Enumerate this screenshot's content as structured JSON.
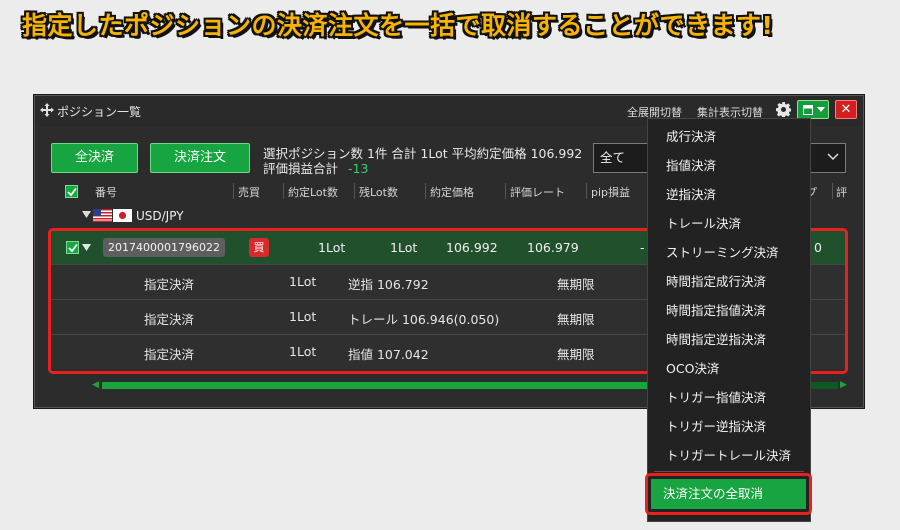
{
  "headline": "指定したポジションの決済注文を一括で取消することができます!",
  "window": {
    "title": "ポジション一覧",
    "expand_toggle": "全展開切替",
    "summary_toggle": "集計表示切替",
    "close_label": "✕"
  },
  "toolbar": {
    "settle_all": "全決済",
    "settle_order": "決済注文",
    "summary_line1": "選択ポジション数 1件  合計 1Lot 平均約定価格 106.992",
    "summary_label2": "評価損益合計",
    "summary_value2": "-13",
    "filter_value": "全て"
  },
  "columns": [
    "番号",
    "売買",
    "約定Lot数",
    "残Lot数",
    "約定価格",
    "評価レート",
    "pip損益",
    "プ",
    "評"
  ],
  "group": {
    "symbol": "USD/JPY"
  },
  "position": {
    "id": "2017400001796022",
    "side": "買",
    "lot": "1Lot",
    "remain": "1Lot",
    "price": "106.992",
    "rate": "106.979",
    "pips": "-",
    "last": "0"
  },
  "orders": [
    {
      "type": "指定決済",
      "lot": "1Lot",
      "detail": "逆指 106.792",
      "expiry": "無期限"
    },
    {
      "type": "指定決済",
      "lot": "1Lot",
      "detail": "トレール 106.946(0.050)",
      "expiry": "無期限"
    },
    {
      "type": "指定決済",
      "lot": "1Lot",
      "detail": "指値 107.042",
      "expiry": "無期限"
    }
  ],
  "menu": {
    "items": [
      "成行決済",
      "指値決済",
      "逆指決済",
      "トレール決済",
      "ストリーミング決済",
      "時間指定成行決済",
      "時間指定指値決済",
      "時間指定逆指決済",
      "OCO決済",
      "トリガー指値決済",
      "トリガー逆指決済",
      "トリガートレール決済"
    ],
    "cancel_all": "決済注文の全取消"
  },
  "colors": {
    "accent_green": "#16a540",
    "highlight_red": "#e82020",
    "headline_yellow": "#f6b400"
  }
}
